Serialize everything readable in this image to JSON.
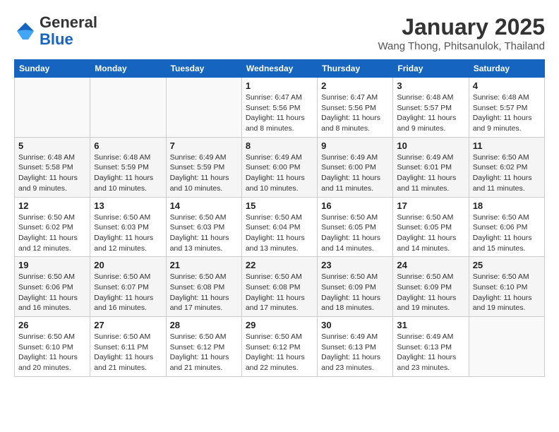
{
  "header": {
    "logo_line1": "General",
    "logo_line2": "Blue",
    "month": "January 2025",
    "location": "Wang Thong, Phitsanulok, Thailand"
  },
  "weekdays": [
    "Sunday",
    "Monday",
    "Tuesday",
    "Wednesday",
    "Thursday",
    "Friday",
    "Saturday"
  ],
  "weeks": [
    [
      {
        "day": "",
        "info": ""
      },
      {
        "day": "",
        "info": ""
      },
      {
        "day": "",
        "info": ""
      },
      {
        "day": "1",
        "info": "Sunrise: 6:47 AM\nSunset: 5:56 PM\nDaylight: 11 hours\nand 8 minutes."
      },
      {
        "day": "2",
        "info": "Sunrise: 6:47 AM\nSunset: 5:56 PM\nDaylight: 11 hours\nand 8 minutes."
      },
      {
        "day": "3",
        "info": "Sunrise: 6:48 AM\nSunset: 5:57 PM\nDaylight: 11 hours\nand 9 minutes."
      },
      {
        "day": "4",
        "info": "Sunrise: 6:48 AM\nSunset: 5:57 PM\nDaylight: 11 hours\nand 9 minutes."
      }
    ],
    [
      {
        "day": "5",
        "info": "Sunrise: 6:48 AM\nSunset: 5:58 PM\nDaylight: 11 hours\nand 9 minutes."
      },
      {
        "day": "6",
        "info": "Sunrise: 6:48 AM\nSunset: 5:59 PM\nDaylight: 11 hours\nand 10 minutes."
      },
      {
        "day": "7",
        "info": "Sunrise: 6:49 AM\nSunset: 5:59 PM\nDaylight: 11 hours\nand 10 minutes."
      },
      {
        "day": "8",
        "info": "Sunrise: 6:49 AM\nSunset: 6:00 PM\nDaylight: 11 hours\nand 10 minutes."
      },
      {
        "day": "9",
        "info": "Sunrise: 6:49 AM\nSunset: 6:00 PM\nDaylight: 11 hours\nand 11 minutes."
      },
      {
        "day": "10",
        "info": "Sunrise: 6:49 AM\nSunset: 6:01 PM\nDaylight: 11 hours\nand 11 minutes."
      },
      {
        "day": "11",
        "info": "Sunrise: 6:50 AM\nSunset: 6:02 PM\nDaylight: 11 hours\nand 11 minutes."
      }
    ],
    [
      {
        "day": "12",
        "info": "Sunrise: 6:50 AM\nSunset: 6:02 PM\nDaylight: 11 hours\nand 12 minutes."
      },
      {
        "day": "13",
        "info": "Sunrise: 6:50 AM\nSunset: 6:03 PM\nDaylight: 11 hours\nand 12 minutes."
      },
      {
        "day": "14",
        "info": "Sunrise: 6:50 AM\nSunset: 6:03 PM\nDaylight: 11 hours\nand 13 minutes."
      },
      {
        "day": "15",
        "info": "Sunrise: 6:50 AM\nSunset: 6:04 PM\nDaylight: 11 hours\nand 13 minutes."
      },
      {
        "day": "16",
        "info": "Sunrise: 6:50 AM\nSunset: 6:05 PM\nDaylight: 11 hours\nand 14 minutes."
      },
      {
        "day": "17",
        "info": "Sunrise: 6:50 AM\nSunset: 6:05 PM\nDaylight: 11 hours\nand 14 minutes."
      },
      {
        "day": "18",
        "info": "Sunrise: 6:50 AM\nSunset: 6:06 PM\nDaylight: 11 hours\nand 15 minutes."
      }
    ],
    [
      {
        "day": "19",
        "info": "Sunrise: 6:50 AM\nSunset: 6:06 PM\nDaylight: 11 hours\nand 16 minutes."
      },
      {
        "day": "20",
        "info": "Sunrise: 6:50 AM\nSunset: 6:07 PM\nDaylight: 11 hours\nand 16 minutes."
      },
      {
        "day": "21",
        "info": "Sunrise: 6:50 AM\nSunset: 6:08 PM\nDaylight: 11 hours\nand 17 minutes."
      },
      {
        "day": "22",
        "info": "Sunrise: 6:50 AM\nSunset: 6:08 PM\nDaylight: 11 hours\nand 17 minutes."
      },
      {
        "day": "23",
        "info": "Sunrise: 6:50 AM\nSunset: 6:09 PM\nDaylight: 11 hours\nand 18 minutes."
      },
      {
        "day": "24",
        "info": "Sunrise: 6:50 AM\nSunset: 6:09 PM\nDaylight: 11 hours\nand 19 minutes."
      },
      {
        "day": "25",
        "info": "Sunrise: 6:50 AM\nSunset: 6:10 PM\nDaylight: 11 hours\nand 19 minutes."
      }
    ],
    [
      {
        "day": "26",
        "info": "Sunrise: 6:50 AM\nSunset: 6:10 PM\nDaylight: 11 hours\nand 20 minutes."
      },
      {
        "day": "27",
        "info": "Sunrise: 6:50 AM\nSunset: 6:11 PM\nDaylight: 11 hours\nand 21 minutes."
      },
      {
        "day": "28",
        "info": "Sunrise: 6:50 AM\nSunset: 6:12 PM\nDaylight: 11 hours\nand 21 minutes."
      },
      {
        "day": "29",
        "info": "Sunrise: 6:50 AM\nSunset: 6:12 PM\nDaylight: 11 hours\nand 22 minutes."
      },
      {
        "day": "30",
        "info": "Sunrise: 6:49 AM\nSunset: 6:13 PM\nDaylight: 11 hours\nand 23 minutes."
      },
      {
        "day": "31",
        "info": "Sunrise: 6:49 AM\nSunset: 6:13 PM\nDaylight: 11 hours\nand 23 minutes."
      },
      {
        "day": "",
        "info": ""
      }
    ]
  ]
}
